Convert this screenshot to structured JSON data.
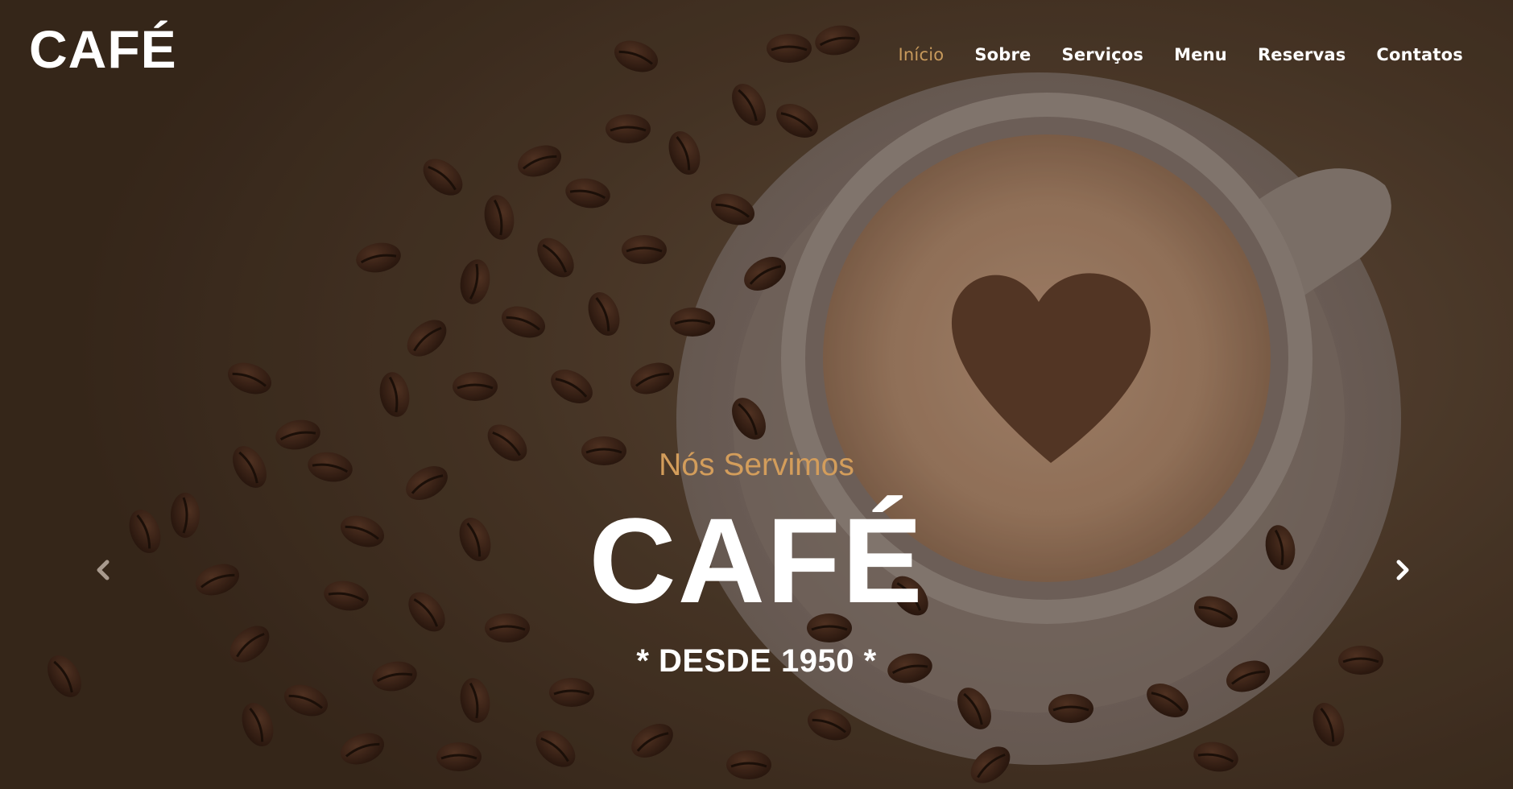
{
  "brand": {
    "logo_text": "CAFÉ",
    "accent_color": "#c89a5c"
  },
  "nav": {
    "items": [
      {
        "label": "Início",
        "active": true
      },
      {
        "label": "Sobre",
        "active": false
      },
      {
        "label": "Serviços",
        "active": false
      },
      {
        "label": "Menu",
        "active": false
      },
      {
        "label": "Reservas",
        "active": false
      },
      {
        "label": "Contatos",
        "active": false
      }
    ]
  },
  "hero": {
    "subtitle": "Nós Servimos",
    "title": "CAFÉ",
    "tagline": "* DESDE 1950 *",
    "background_image": "coffee-cup-with-heart-latte-art-and-coffee-beans"
  },
  "carousel": {
    "prev_icon": "chevron-left-icon",
    "next_icon": "chevron-right-icon"
  }
}
